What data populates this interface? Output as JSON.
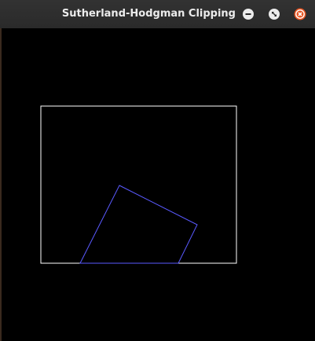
{
  "window": {
    "title": "Sutherland-Hodgman Clipping"
  },
  "controls": {
    "minimize_icon": "minimize-icon",
    "maximize_icon": "maximize-icon",
    "close_icon": "close-icon",
    "close_color": "#e95420",
    "button_color": "#ececec"
  },
  "scene": {
    "background_color": "#000000",
    "clip_window_color": "#ffffff",
    "polygon_color": "#5a5aff"
  }
}
